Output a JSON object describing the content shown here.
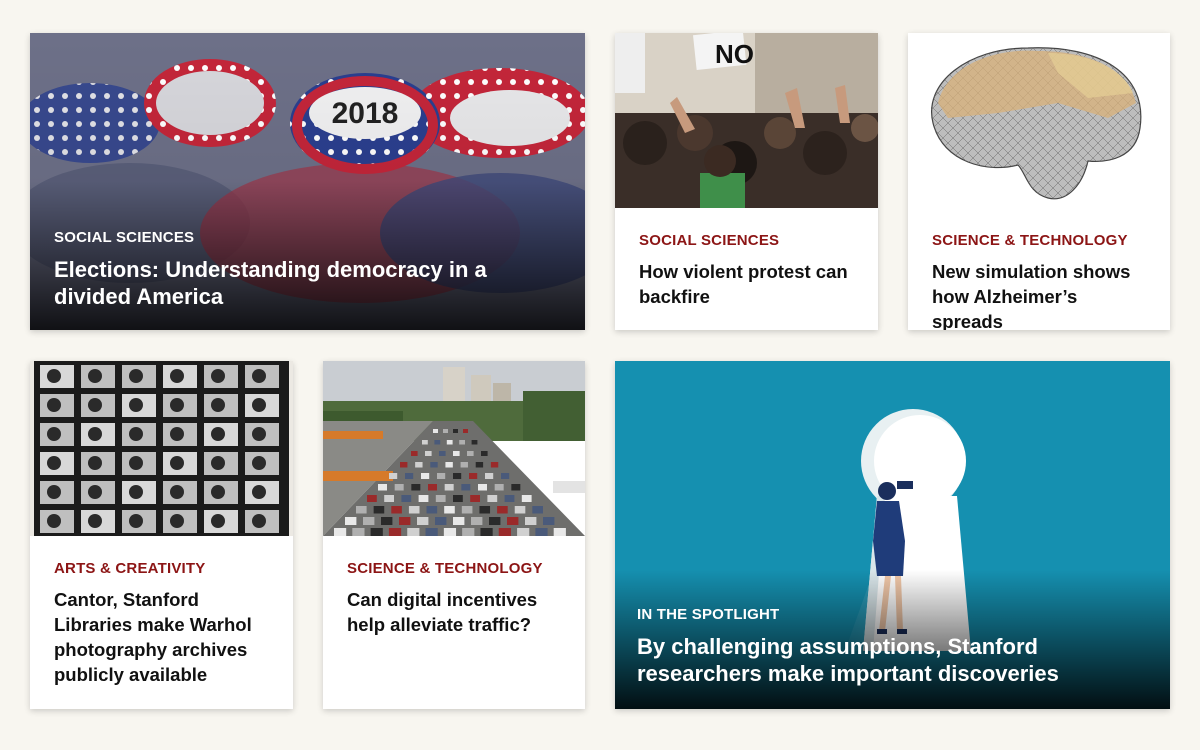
{
  "cards": [
    {
      "kicker": "SOCIAL SCIENCES",
      "headline": "Elections: Understanding democracy in a divided America",
      "image": "campaign-buttons-2018-photo",
      "button_text": "2018"
    },
    {
      "kicker": "SOCIAL SCIENCES",
      "headline": "How violent protest can backfire",
      "image": "protest-crowd-photo",
      "sign_text": "NO"
    },
    {
      "kicker": "SCIENCE & TECHNOLOGY",
      "headline": "New simulation shows how Alzheimer’s spreads",
      "image": "brain-mesh-simulation"
    },
    {
      "kicker": "ARTS & CREATIVITY",
      "headline": "Cantor, Stanford Libraries make Warhol photography archives publicly available",
      "image": "warhol-contact-sheet-photo"
    },
    {
      "kicker": "SCIENCE & TECHNOLOGY",
      "headline": "Can digital incentives help alleviate traffic?",
      "image": "freeway-traffic-photo"
    },
    {
      "kicker": "IN THE SPOTLIGHT",
      "headline": "By challenging assumptions, Stanford researchers make important discoveries",
      "image": "keyhole-illustration"
    }
  ],
  "colors": {
    "page_bg": "#f8f6f0",
    "kicker_red": "#8c1515",
    "spotlight_blue": "#1590b0"
  }
}
